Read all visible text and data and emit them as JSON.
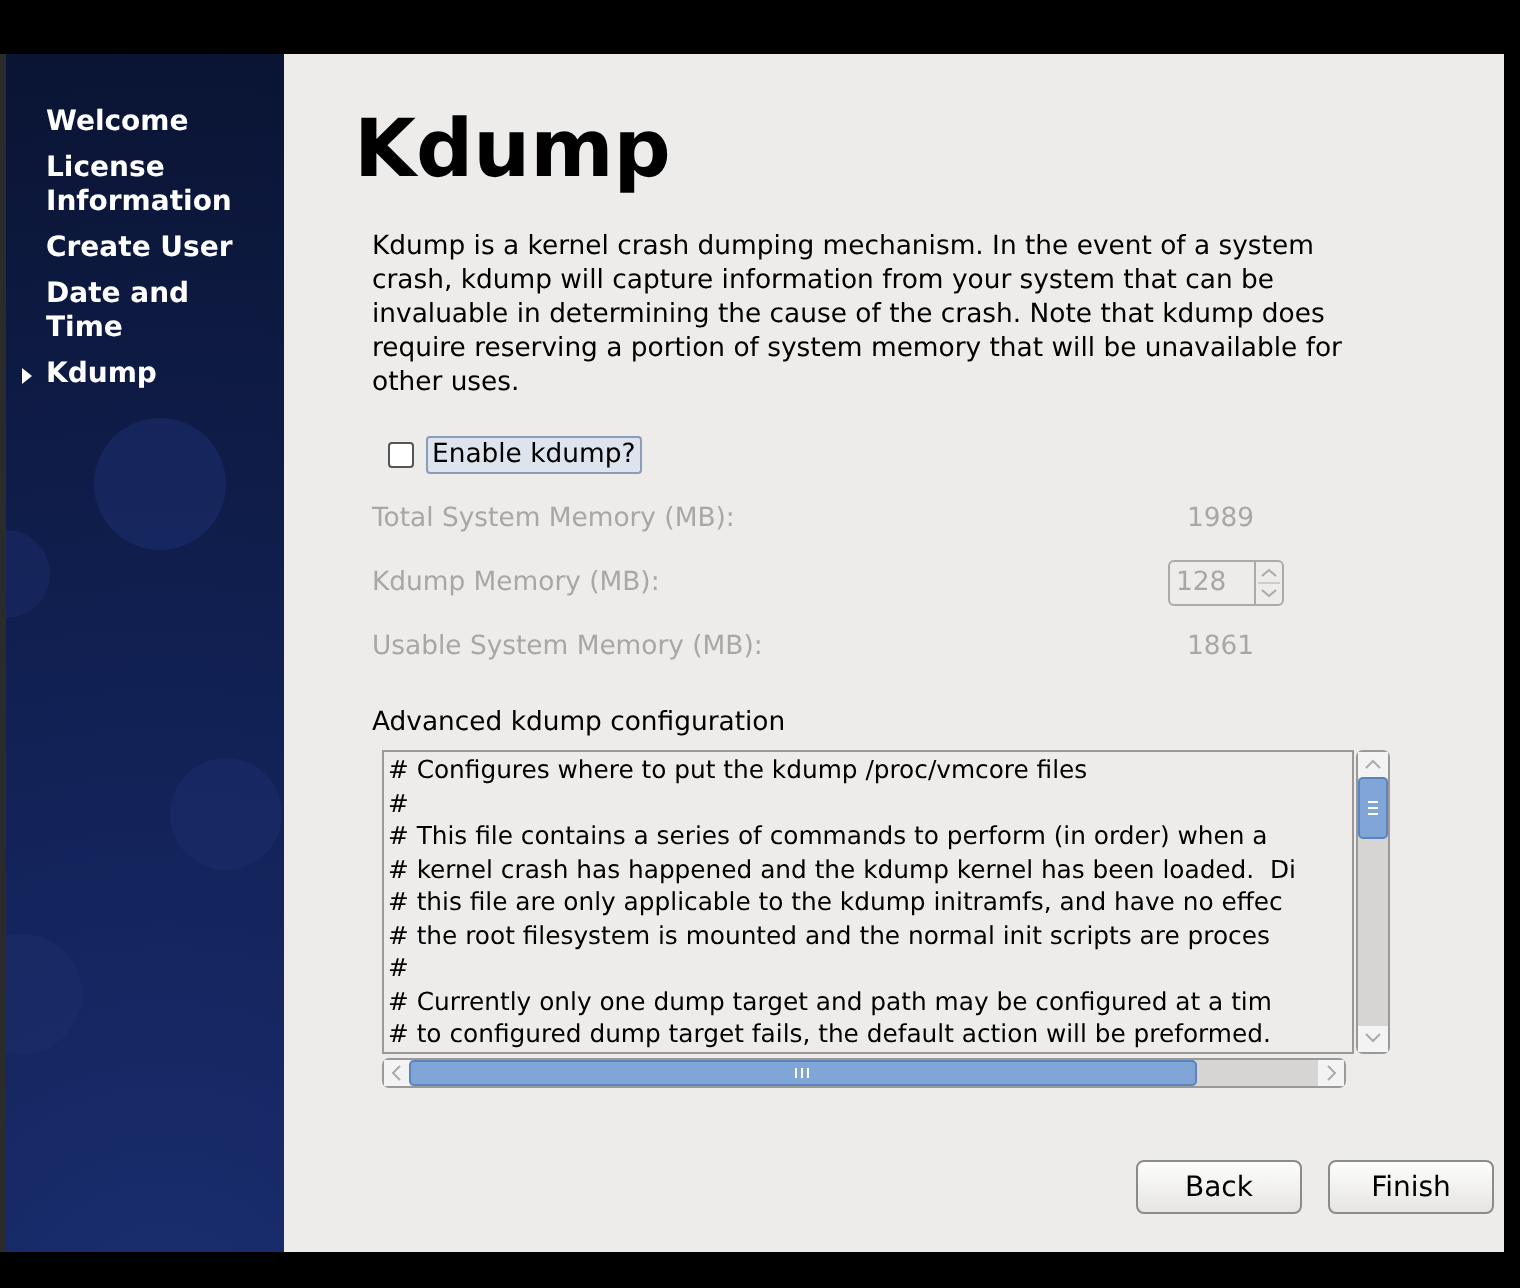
{
  "sidebar": {
    "items": [
      {
        "label": "Welcome",
        "selected": false
      },
      {
        "label": "License Information",
        "selected": false
      },
      {
        "label": "Create User",
        "selected": false
      },
      {
        "label": "Date and Time",
        "selected": false
      },
      {
        "label": "Kdump",
        "selected": true
      }
    ]
  },
  "page": {
    "title": "Kdump",
    "description": "Kdump is a kernel crash dumping mechanism. In the event of a system crash, kdump will capture information from your system that can be invaluable in determining the cause of the crash. Note that kdump does require reserving a portion of system memory that will be unavailable for other uses.",
    "enable": {
      "label": "Enable kdump?",
      "checked": false
    },
    "memory": {
      "disabled": true,
      "rows": [
        {
          "kind": "value",
          "label": "Total System Memory (MB):",
          "value": "1989"
        },
        {
          "kind": "spin",
          "label": "Kdump Memory (MB):",
          "value": "128"
        },
        {
          "kind": "value",
          "label": "Usable System Memory (MB):",
          "value": "1861"
        }
      ]
    },
    "advanced": {
      "label": "Advanced kdump configuration",
      "lines": [
        "# Configures where to put the kdump /proc/vmcore files",
        "#",
        "# This file contains a series of commands to perform (in order) when a",
        "# kernel crash has happened and the kdump kernel has been loaded.  Di",
        "# this file are only applicable to the kdump initramfs, and have no effec",
        "# the root filesystem is mounted and the normal init scripts are proces",
        "#",
        "# Currently only one dump target and path may be configured at a tim",
        "# to configured dump target fails, the default action will be preformed."
      ]
    },
    "buttons": [
      "Back",
      "Finish"
    ]
  }
}
